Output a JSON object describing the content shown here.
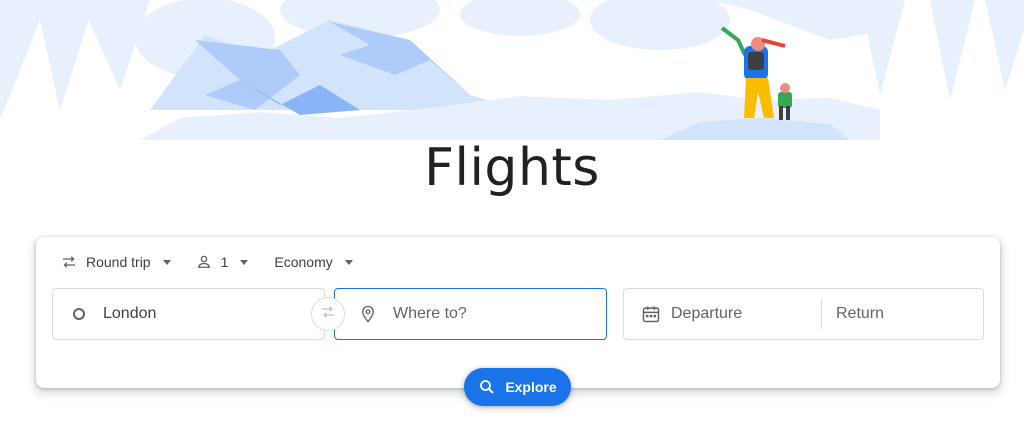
{
  "page": {
    "title": "Flights"
  },
  "options": {
    "trip_type": "Round trip",
    "passengers": "1",
    "cabin_class": "Economy"
  },
  "search": {
    "origin": "London",
    "destination_placeholder": "Where to?",
    "departure": "Departure",
    "return": "Return"
  },
  "actions": {
    "explore": "Explore"
  },
  "colors": {
    "accent": "#1a73e8",
    "illustration": "#aecbfa"
  },
  "icons": {
    "trip": "swap-horizontal-icon",
    "passengers": "person-icon",
    "origin": "circle-icon",
    "swap": "swap-icon",
    "destination": "location-pin-icon",
    "dates": "calendar-icon",
    "explore": "search-icon"
  }
}
